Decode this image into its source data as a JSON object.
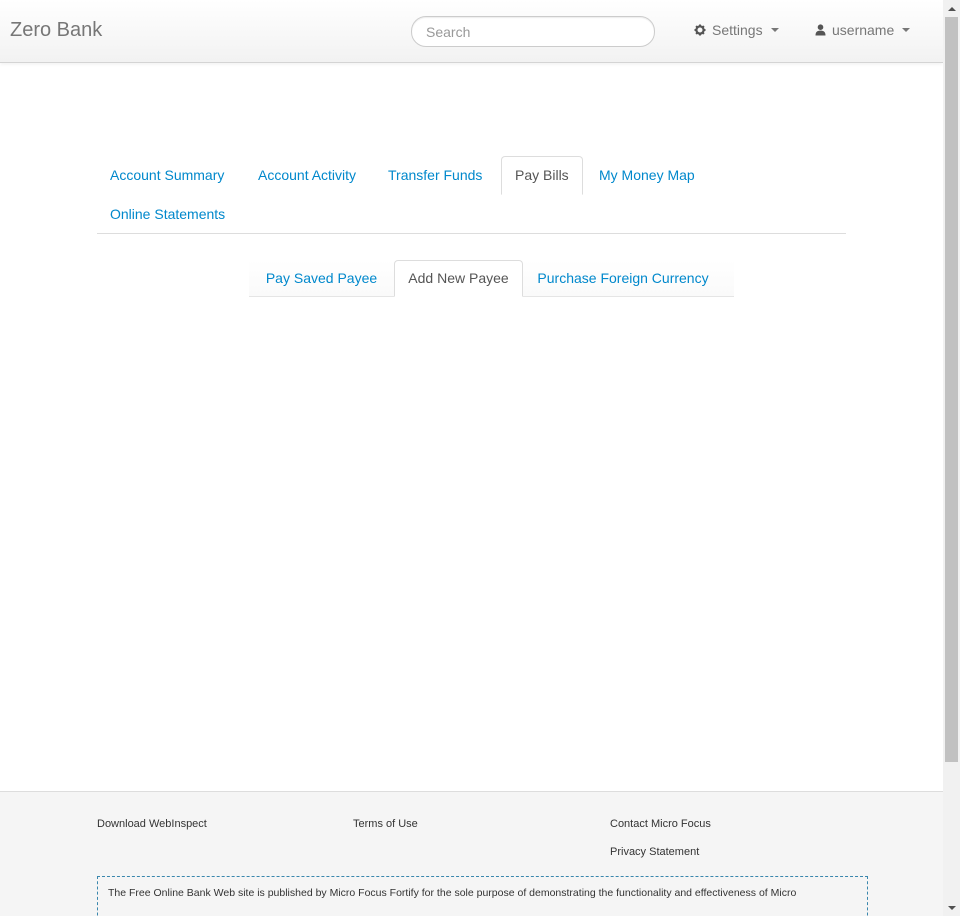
{
  "navbar": {
    "brand": "Zero Bank",
    "search_placeholder": "Search",
    "settings_label": "Settings",
    "user_label": "username"
  },
  "tabs": [
    {
      "label": "Account Summary",
      "active": false
    },
    {
      "label": "Account Activity",
      "active": false
    },
    {
      "label": "Transfer Funds",
      "active": false
    },
    {
      "label": "Pay Bills",
      "active": true
    },
    {
      "label": "My Money Map",
      "active": false
    },
    {
      "label": "Online Statements",
      "active": false
    }
  ],
  "subtabs": [
    {
      "label": "Pay Saved Payee",
      "active": false
    },
    {
      "label": "Add New Payee",
      "active": true
    },
    {
      "label": "Purchase Foreign Currency",
      "active": false
    }
  ],
  "footer": {
    "download": "Download WebInspect",
    "terms": "Terms of Use",
    "contact": "Contact Micro Focus",
    "privacy": "Privacy Statement",
    "disclaimer": "The Free Online Bank Web site is published by Micro Focus Fortify for the sole purpose of demonstrating the functionality and effectiveness of Micro"
  },
  "colors": {
    "link": "#0088cc",
    "brand_text": "#777777",
    "disclaimer_border": "#3a87ad"
  },
  "icons": [
    "gear-icon",
    "user-icon",
    "caret-down-icon",
    "scroll-up-icon",
    "scroll-down-icon"
  ]
}
